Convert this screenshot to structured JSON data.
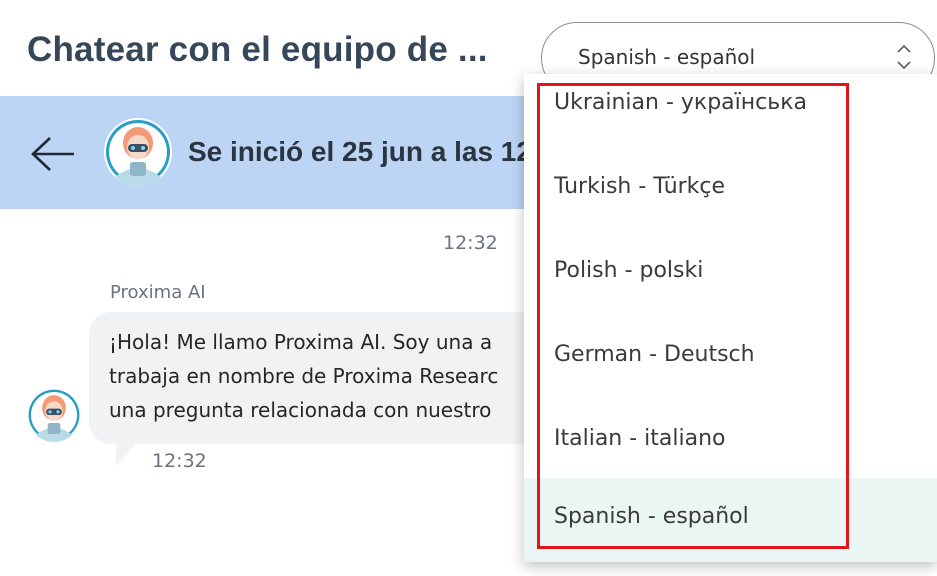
{
  "header": {
    "title": "Chatear con el equipo de ...",
    "language_select": {
      "value": "Spanish - español"
    }
  },
  "banner": {
    "text": "Se inició el 25 jun a las 12"
  },
  "chat": {
    "timestamp_top": "12:32",
    "message": {
      "sender": "Proxima AI",
      "lines": [
        "¡Hola! Me llamo Proxima AI. Soy una a",
        "trabaja en nombre de Proxima Researc",
        "una pregunta relacionada con nuestro"
      ],
      "timestamp": "12:32"
    }
  },
  "dropdown": {
    "options": [
      {
        "label": "Ukrainian - українська",
        "selected": false
      },
      {
        "label": "Turkish - Türkçe",
        "selected": false
      },
      {
        "label": "Polish - polski",
        "selected": false
      },
      {
        "label": "German - Deutsch",
        "selected": false
      },
      {
        "label": "Italian - italiano",
        "selected": false
      },
      {
        "label": "Spanish - español",
        "selected": true
      }
    ]
  },
  "colors": {
    "banner_bg": "#bcd5f4",
    "title": "#36475a",
    "highlight_border": "#e0161a",
    "selected_option_bg": "#e9f6f3",
    "bubble_bg": "#f1f2f4"
  },
  "icons": {
    "back": "arrow-left-icon",
    "select_arrows": "chevron-up-down-icon",
    "avatar": "robot-avatar-icon"
  }
}
